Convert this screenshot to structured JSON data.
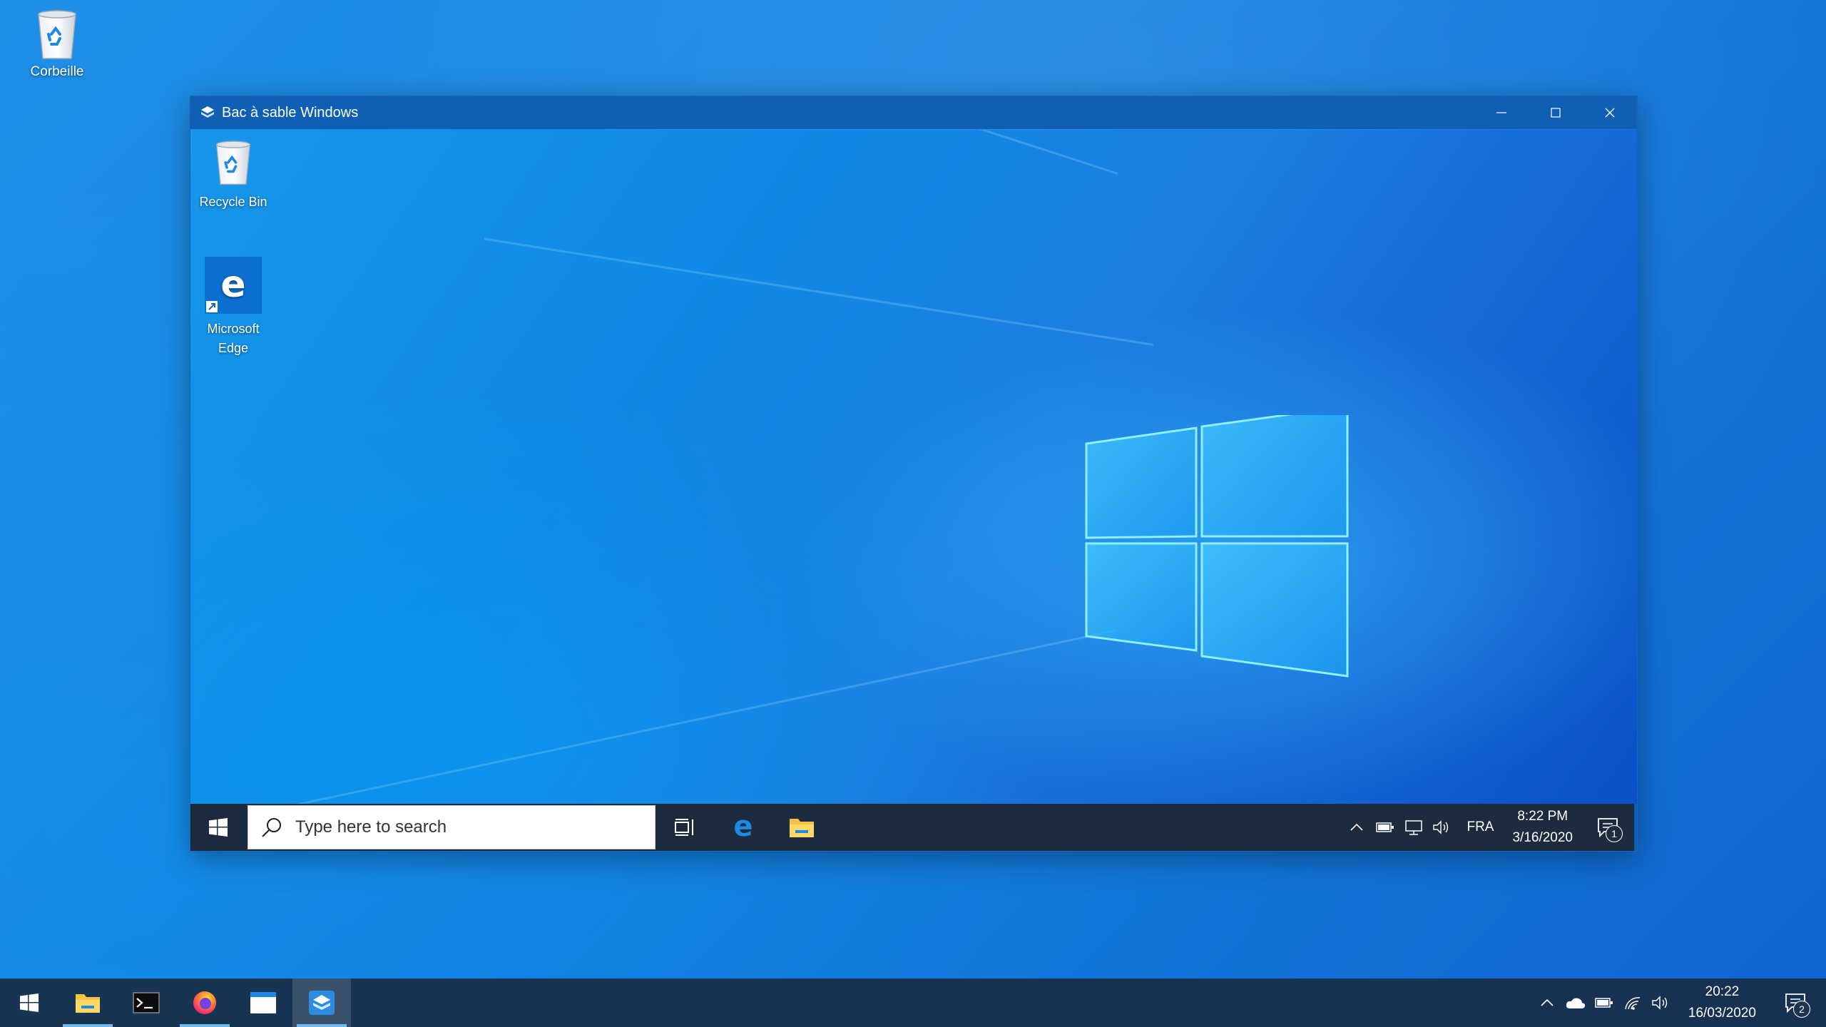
{
  "host_desktop": {
    "icons": [
      {
        "label": "Corbeille"
      }
    ]
  },
  "window": {
    "title": "Bac à sable Windows",
    "icon": "sandbox-icon",
    "controls": [
      "minimize-icon",
      "maximize-icon",
      "close-icon"
    ]
  },
  "guest_desktop": {
    "icons": [
      {
        "label": "Recycle Bin"
      },
      {
        "label": "Microsoft Edge"
      }
    ]
  },
  "guest_taskbar": {
    "search_placeholder": "Type here to search",
    "apps": [
      "task-view-icon",
      "edge-icon",
      "file-explorer-icon"
    ],
    "language": "FRA",
    "time": "8:22 PM",
    "date": "3/16/2020",
    "notification_count": "1"
  },
  "host_taskbar": {
    "apps": [
      "file-explorer-icon",
      "terminal-icon",
      "firefox-icon",
      "window-app-icon",
      "sandbox-icon"
    ],
    "time": "20:22",
    "date": "16/03/2020",
    "notification_count": "2"
  }
}
